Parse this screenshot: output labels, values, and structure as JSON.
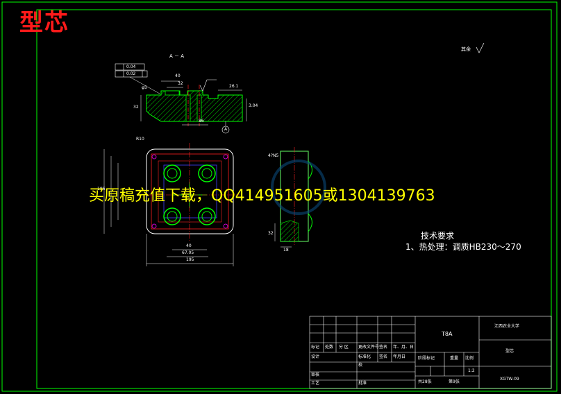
{
  "title": "型芯",
  "watermark": "买原稿充值下载，QQ414951605或1304139763",
  "section_label": "A － A",
  "roughness_note": "其余",
  "tech_requirements": {
    "heading": "技术要求",
    "item1": "1、热处理：调质HB230～270"
  },
  "dimensions": {
    "d40_top": "40",
    "d32": "32",
    "phi5": "φ5",
    "d32_side": "32",
    "d26": "26.1",
    "d3_04": "3.04",
    "d86": "86",
    "r10": "R10",
    "d186": "186",
    "d40_bottom": "40",
    "d67": "67.05",
    "d195": "195",
    "d18": "18",
    "d32_right": "32",
    "d4": "4?N5",
    "tol1": "0.04",
    "tol2": "0.02",
    "sec_a": "A"
  },
  "title_block": {
    "code": "T8A",
    "university": "江西农业大学",
    "part_name": "型芯",
    "drawing_no": "XGTW-09",
    "scale": "1:2",
    "sheets_total": "共28张",
    "sheet_no": "第9张",
    "mark": "标记",
    "count": "处数",
    "zone": "分 区",
    "change_doc": "更改文件号",
    "sign": "签名",
    "date": "年、月、日",
    "design": "设计",
    "standard": "标准化",
    "sign2": "签名",
    "date2": "年月日",
    "stage_mark": "阶段标记",
    "weight": "重量",
    "ratio": "比例",
    "review": "审核",
    "process": "工艺",
    "approve": "批准",
    "check": "校"
  },
  "colors": {
    "frame": "#00ff00",
    "part": "#00ff00",
    "center": "#ff2020",
    "dim": "#ffffff",
    "hatch": "#00ff00",
    "blue": "#4040ff",
    "cyan": "#00ffff",
    "magenta": "#ff00ff"
  }
}
